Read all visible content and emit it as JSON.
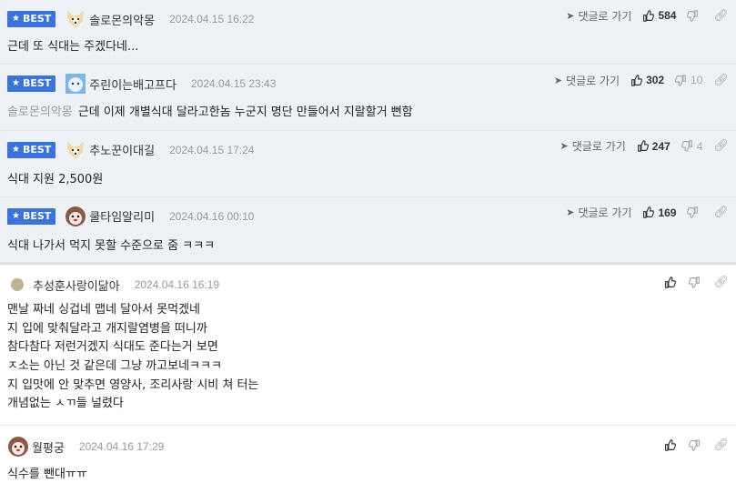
{
  "best_comments": [
    {
      "badge": "BEST",
      "nick": "솔로몬의악몽",
      "date": "2024.04.15 16:22",
      "goto": "댓글로 가기",
      "likes": "584",
      "dislikes": "",
      "reply_to": "",
      "text": "근데 또 식대는 주겠다네..."
    },
    {
      "badge": "BEST",
      "nick": "주린이는배고프다",
      "date": "2024.04.15 23:43",
      "goto": "댓글로 가기",
      "likes": "302",
      "dislikes": "10",
      "reply_to": "솔로몬의악몽",
      "text": "근데 이제 개별식대 달라고한놈 누군지 명단 만들어서 지랄할거 뻔함"
    },
    {
      "badge": "BEST",
      "nick": "추노꾼이대길",
      "date": "2024.04.15 17:24",
      "goto": "댓글로 가기",
      "likes": "247",
      "dislikes": "4",
      "reply_to": "",
      "text": "식대 지원 2,500원"
    },
    {
      "badge": "BEST",
      "nick": "쿨타임알리미",
      "date": "2024.04.16 00:10",
      "goto": "댓글로 가기",
      "likes": "169",
      "dislikes": "",
      "reply_to": "",
      "text": "식대 나가서 먹지 못할 수준으로 줌 ㅋㅋㅋ"
    }
  ],
  "comments": [
    {
      "nick": "추성훈사랑이닮아",
      "date": "2024.04.16 16:19",
      "lines": [
        "맨날 짜네 싱겁네 맵네 달아서 못먹겠네",
        "지 입에 맞춰달라고 개지랄염병을 떠니까",
        "참다참다 저런거겠지 식대도 준다는거 보면",
        "ㅈ소는 아닌 것 같은데 그냥 까고보네ㅋㅋㅋ",
        "지 입맛에 안 맞추면 영양사, 조리사랑 시비 쳐 터는",
        "개념없는 ㅅㄲ들 널렸다"
      ]
    },
    {
      "nick": "월평궁",
      "date": "2024.04.16 17:29",
      "lines": [
        "식수를 뺀대ㅠㅠ"
      ]
    }
  ],
  "colors": {
    "badge": "#3b73d9",
    "best_bg": "#eef2f7"
  }
}
